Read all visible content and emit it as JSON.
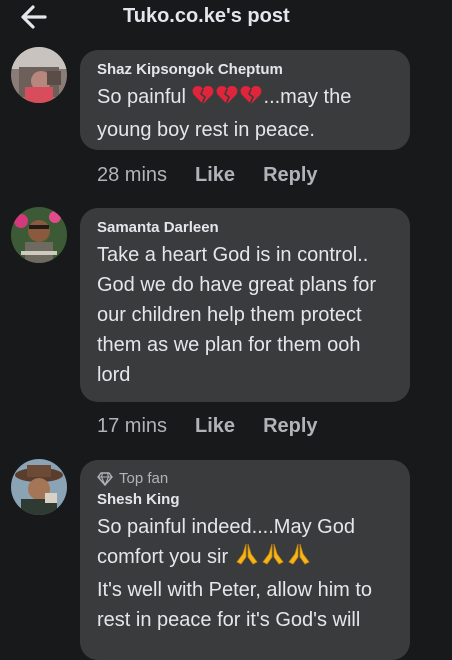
{
  "header": {
    "title": "Tuko.co.ke's post",
    "back_icon": "arrow-left-icon"
  },
  "comments": [
    {
      "author": "Shaz Kipsongok Cheptum",
      "text_before": "So painful ",
      "text_after": "...may the young boy rest in peace.",
      "emoji": "broken-heart-icon",
      "emoji_count": 3,
      "time": "28 mins",
      "like_label": "Like",
      "reply_label": "Reply"
    },
    {
      "author": "Samanta Darleen",
      "text": "Take a heart God is in control.. God we do have great plans for our children help them protect them as we plan for them ooh lord",
      "time": "17 mins",
      "like_label": "Like",
      "reply_label": "Reply"
    },
    {
      "badge": "Top fan",
      "badge_icon": "diamond-icon",
      "author": "Shesh King",
      "text_before": "So painful indeed....May God comfort you sir ",
      "emoji": "praying-hands-icon",
      "emoji_count": 3,
      "text_after": "It's well with Peter, allow him to rest in peace for it's God's will"
    }
  ],
  "colors": {
    "background": "#18191a",
    "bubble": "#3a3b3c",
    "primary_text": "#e4e6eb",
    "secondary_text": "#b0b3b8",
    "broken_heart": "#e0243b",
    "praying_hands": "#f5b51b"
  }
}
